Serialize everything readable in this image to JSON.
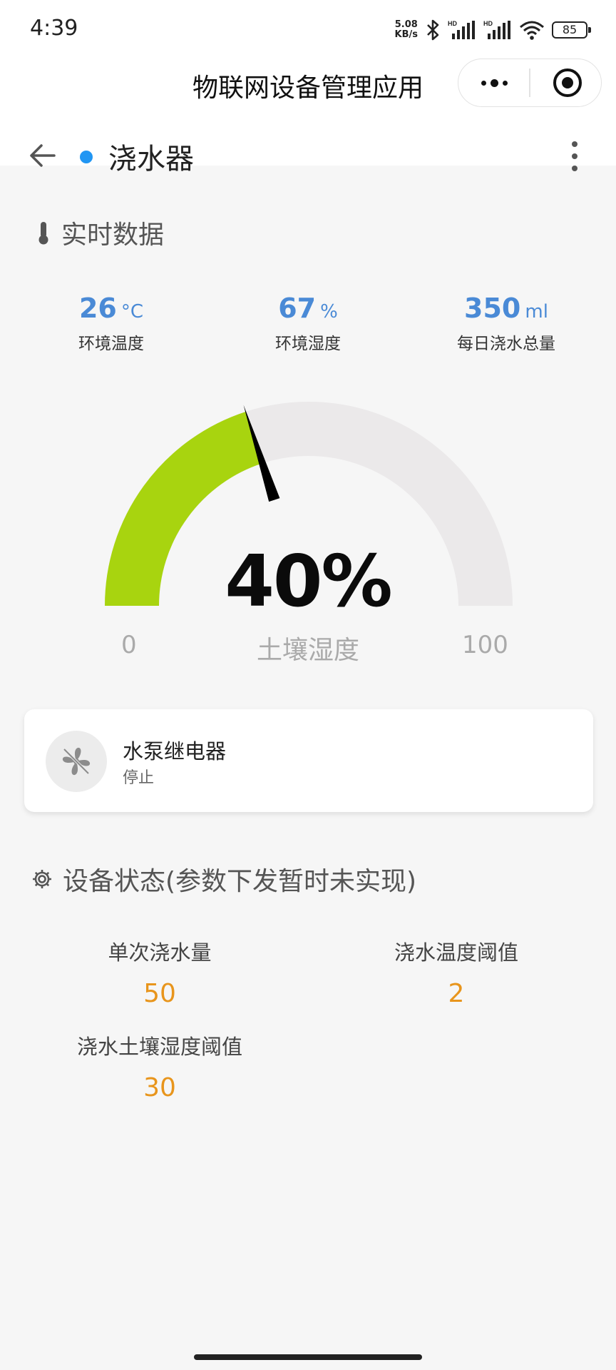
{
  "status_bar": {
    "time": "4:39",
    "net_speed_value": "5.08",
    "net_speed_unit": "KB/s",
    "battery": "85"
  },
  "app": {
    "title": "物联网设备管理应用"
  },
  "device": {
    "name": "浇水器",
    "online_color": "#2196f3"
  },
  "realtime": {
    "section_title": "实时数据",
    "metrics": [
      {
        "value": "26",
        "unit": "°C",
        "label": "环境温度"
      },
      {
        "value": "67",
        "unit": "%",
        "label": "环境湿度"
      },
      {
        "value": "350",
        "unit": "ml",
        "label": "每日浇水总量"
      }
    ]
  },
  "gauge": {
    "value_text": "40%",
    "value": 40,
    "min": "0",
    "max": "100",
    "label": "土壤湿度",
    "fill_color": "#a8d40f",
    "track_color": "#ebe9ea"
  },
  "relay": {
    "name": "水泵继电器",
    "state": "停止",
    "icon": "fan-icon"
  },
  "device_status": {
    "section_title": "设备状态(参数下发暂时未实现)",
    "settings": [
      {
        "label": "单次浇水量",
        "value": "50"
      },
      {
        "label": "浇水温度阈值",
        "value": "2"
      },
      {
        "label": "浇水土壤湿度阈值",
        "value": "30"
      }
    ]
  }
}
